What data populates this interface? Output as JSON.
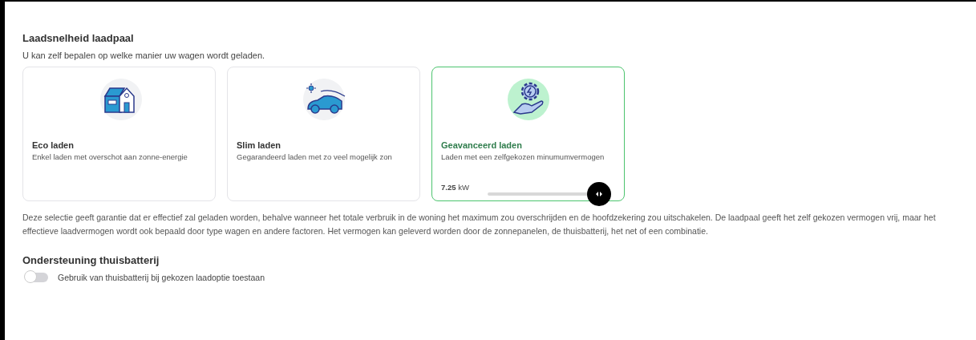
{
  "section": {
    "title": "Laadsnelheid laadpaal",
    "subtitle": "U kan zelf bepalen op welke manier uw wagen wordt geladen."
  },
  "options": [
    {
      "kind": "house",
      "title": "Eco laden",
      "description": "Enkel laden met overschot aan zonne-energie",
      "selected": false
    },
    {
      "kind": "car",
      "title": "Slim laden",
      "description": "Gegarandeerd laden met zo veel mogelijk zon",
      "selected": false
    },
    {
      "kind": "gear",
      "title": "Geavanceerd laden",
      "description": "Laden met een zelfgekozen minumumvermogen",
      "selected": true,
      "power_value": "7.25",
      "power_unit": "kW",
      "level": 0.92
    }
  ],
  "explanation": "Deze selectie geeft garantie dat er effectief zal geladen worden, behalve wanneer het totale verbruik in de woning het maximum zou overschrijden en de hoofdzekering zou uitschakelen. De laadpaal geeft het zelf gekozen vermogen vrij, maar het effectieve laadvermogen wordt ook bepaald door type wagen en andere factoren. Het vermogen kan geleverd worden door de zonnepanelen, de thuisbatterij, het net of een combinatie.",
  "battery": {
    "title": "Ondersteuning thuisbatterij",
    "toggle_label": "Gebruik van thuisbatterij bij gekozen laadoptie toestaan",
    "on": false
  }
}
